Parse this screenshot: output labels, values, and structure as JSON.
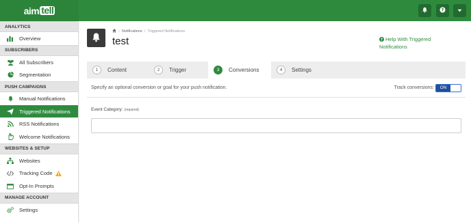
{
  "brand": {
    "logo_prefix": "aim",
    "logo_box": "tell"
  },
  "topbar": {
    "icons": [
      "bell-icon",
      "help-icon",
      "dropdown-caret-icon"
    ]
  },
  "colors": {
    "brand_green": "#2e8b3e",
    "toggle_blue": "#1f4f9d"
  },
  "sidebar": {
    "sections": [
      {
        "title": "ANALYTICS",
        "items": [
          {
            "label": "Overview",
            "icon": "overview-icon"
          }
        ]
      },
      {
        "title": "SUBSCRIBERS",
        "items": [
          {
            "label": "All Subscribers",
            "icon": "users-icon"
          },
          {
            "label": "Segmentation",
            "icon": "pie-icon"
          }
        ]
      },
      {
        "title": "PUSH CAMPAIGNS",
        "items": [
          {
            "label": "Manual Notifications",
            "icon": "bell-icon"
          },
          {
            "label": "Triggered Notifications",
            "icon": "send-icon",
            "active": true
          },
          {
            "label": "RSS Notifications",
            "icon": "rss-icon"
          },
          {
            "label": "Welcome Notifications",
            "icon": "hand-icon"
          }
        ]
      },
      {
        "title": "WEBSITES & SETUP",
        "items": [
          {
            "label": "Websites",
            "icon": "sitemap-icon"
          },
          {
            "label": "Tracking Code",
            "icon": "code-icon",
            "warning": true
          },
          {
            "label": "Opt-In Prompts",
            "icon": "window-icon"
          }
        ]
      },
      {
        "title": "MANAGE ACCOUNT",
        "items": [
          {
            "label": "Settings",
            "icon": "cogs-icon"
          }
        ]
      }
    ]
  },
  "breadcrumb": {
    "level1": "Notifications",
    "level2": "Triggered Notifications"
  },
  "page": {
    "title": "test",
    "help_link": "Help With Triggered Notifications"
  },
  "tabs": [
    {
      "num": "1",
      "label": "Content"
    },
    {
      "num": "2",
      "label": "Trigger"
    },
    {
      "num": "3",
      "label": "Conversions",
      "active": true
    },
    {
      "num": "4",
      "label": "Settings"
    }
  ],
  "conversions": {
    "description": "Specify an optional conversion or goal for your push notification.",
    "track_label": "Track conversions:",
    "toggle_on": "ON",
    "event_category_label": "Event Category:",
    "event_category_required": "(required)",
    "event_category_value": ""
  }
}
